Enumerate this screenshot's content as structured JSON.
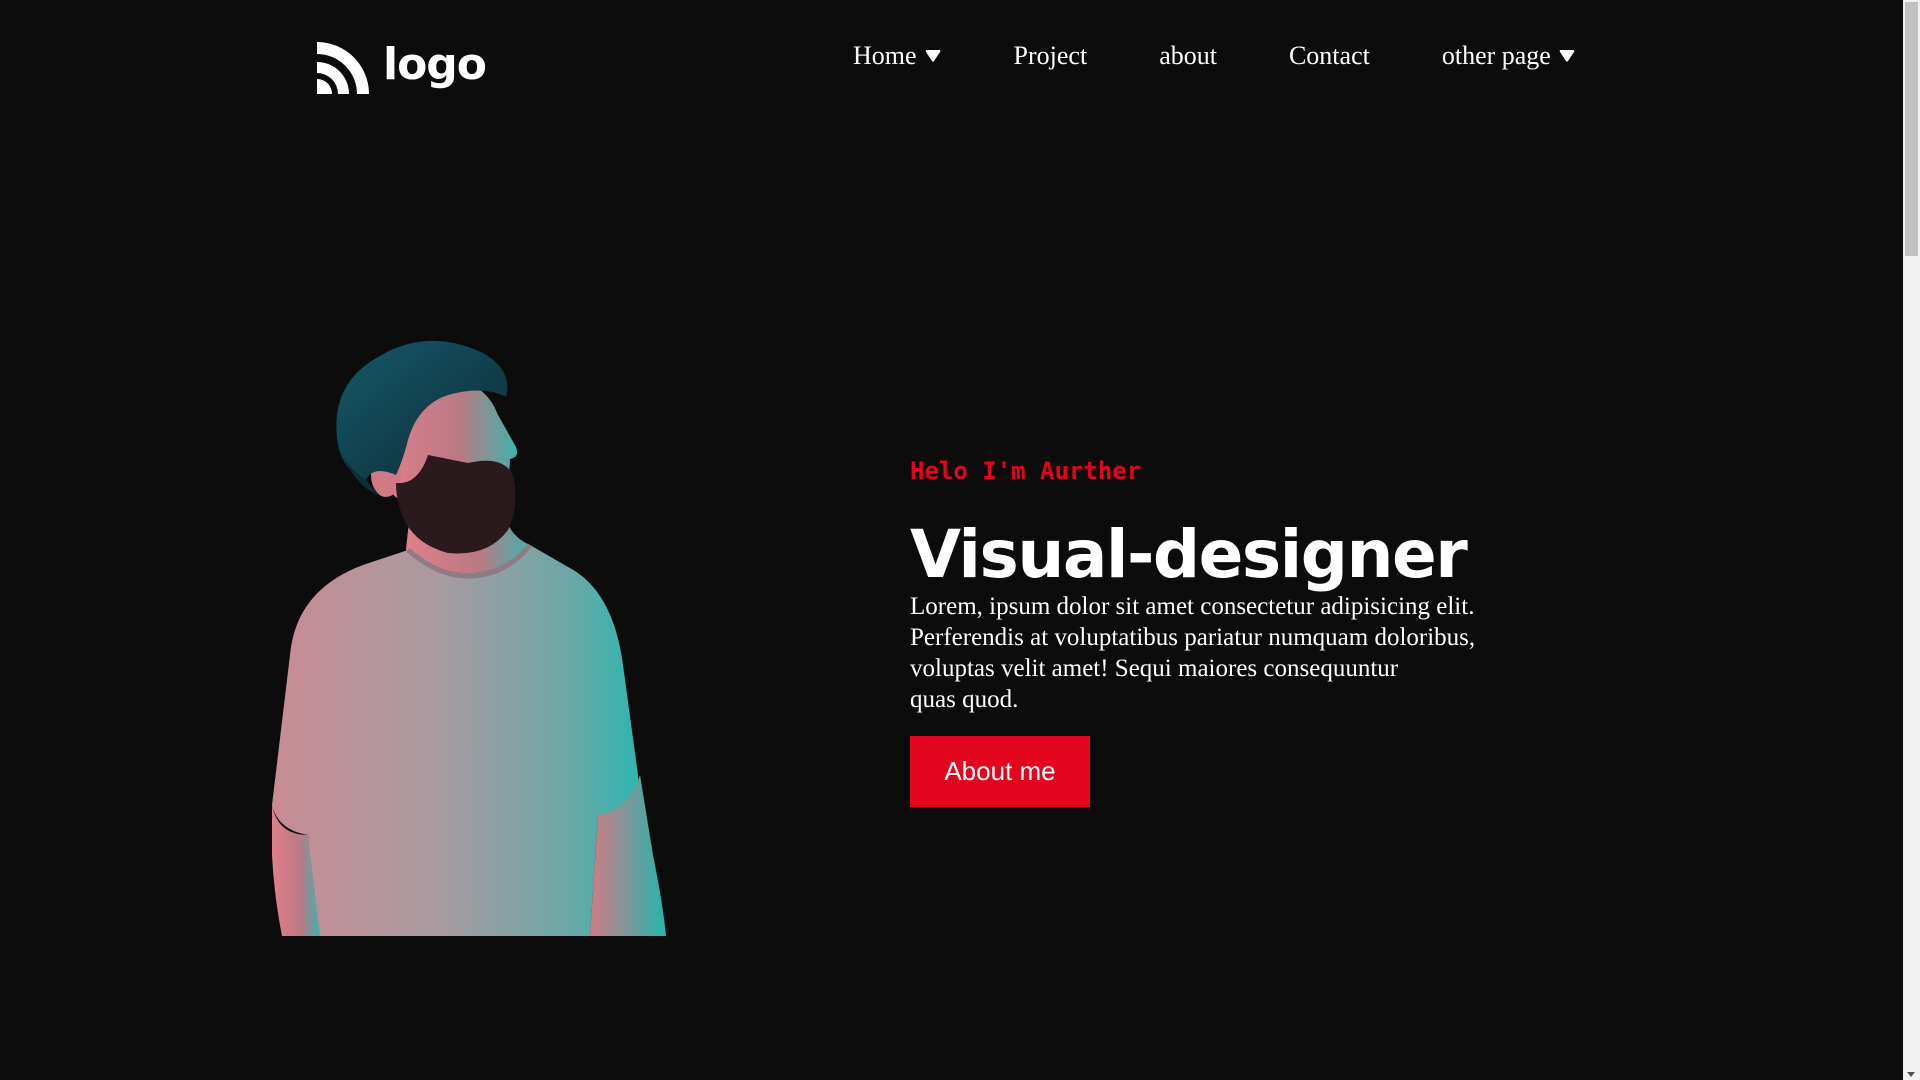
{
  "header": {
    "logo_text": "logo",
    "nav": [
      {
        "label": "Home",
        "has_dropdown": true
      },
      {
        "label": "Project",
        "has_dropdown": false
      },
      {
        "label": "about",
        "has_dropdown": false
      },
      {
        "label": "Contact",
        "has_dropdown": false
      },
      {
        "label": "other page",
        "has_dropdown": true
      }
    ]
  },
  "hero": {
    "greeting": "Helo I'm Aurther",
    "title": "Visual-designer",
    "description_lines": [
      "Lorem, ipsum dolor sit amet consectetur adipisicing elit.",
      "Perferendis at voluptatibus pariatur numquam doloribus,",
      "voluptas velit amet! Sequi maiores consequuntur",
      "quas quod."
    ],
    "cta_label": "About me"
  },
  "colors": {
    "background": "#0c0c0c",
    "accent": "#e3051d",
    "text": "#ffffff"
  },
  "icons": {
    "logo": "rss-arcs-icon",
    "dropdown": "caret-down-icon"
  }
}
